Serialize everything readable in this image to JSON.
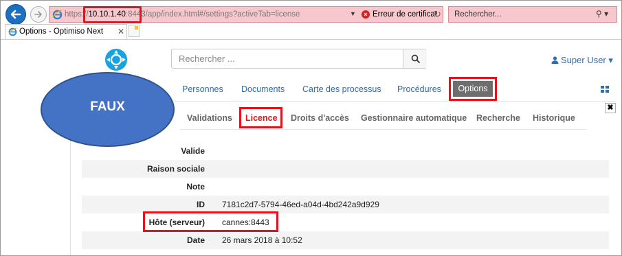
{
  "browser": {
    "url_proto": "https://",
    "url_host": "10.10.1.40",
    "url_port": ":8443",
    "url_path": "/app/index.html#/settings?activeTab=license",
    "cert_error": "Erreur de certificat",
    "search_placeholder": "Rechercher...",
    "tab_title": "Options - Optimiso Next"
  },
  "header": {
    "search_placeholder": "Rechercher ...",
    "user": "Super User"
  },
  "main_nav": {
    "items": [
      "Personnes",
      "Documents",
      "Carte des processus",
      "Procédures",
      "Options"
    ],
    "active": "Options"
  },
  "sub_tabs": {
    "items": [
      "Validations",
      "Licence",
      "Droits d'accès",
      "Gestionnaire automatique",
      "Recherche",
      "Historique"
    ],
    "active": "Licence"
  },
  "license": {
    "rows": [
      {
        "label": "Valide",
        "value": ""
      },
      {
        "label": "Raison sociale",
        "value": ""
      },
      {
        "label": "Note",
        "value": ""
      },
      {
        "label": "ID",
        "value": "7181c2d7-5794-46ed-a04d-4bd242a9d929"
      },
      {
        "label": "Hôte (serveur)",
        "value": "cannes:8443"
      },
      {
        "label": "Date",
        "value": "26 mars 2018 à 10:52"
      }
    ]
  },
  "annotation": {
    "label": "FAUX"
  },
  "colors": {
    "highlight": "#e8101a",
    "link": "#2a6db5",
    "address_bar_error": "#f6c8cd",
    "active_tab_bg": "#6e6e6e",
    "bubble": "#4473c5"
  }
}
